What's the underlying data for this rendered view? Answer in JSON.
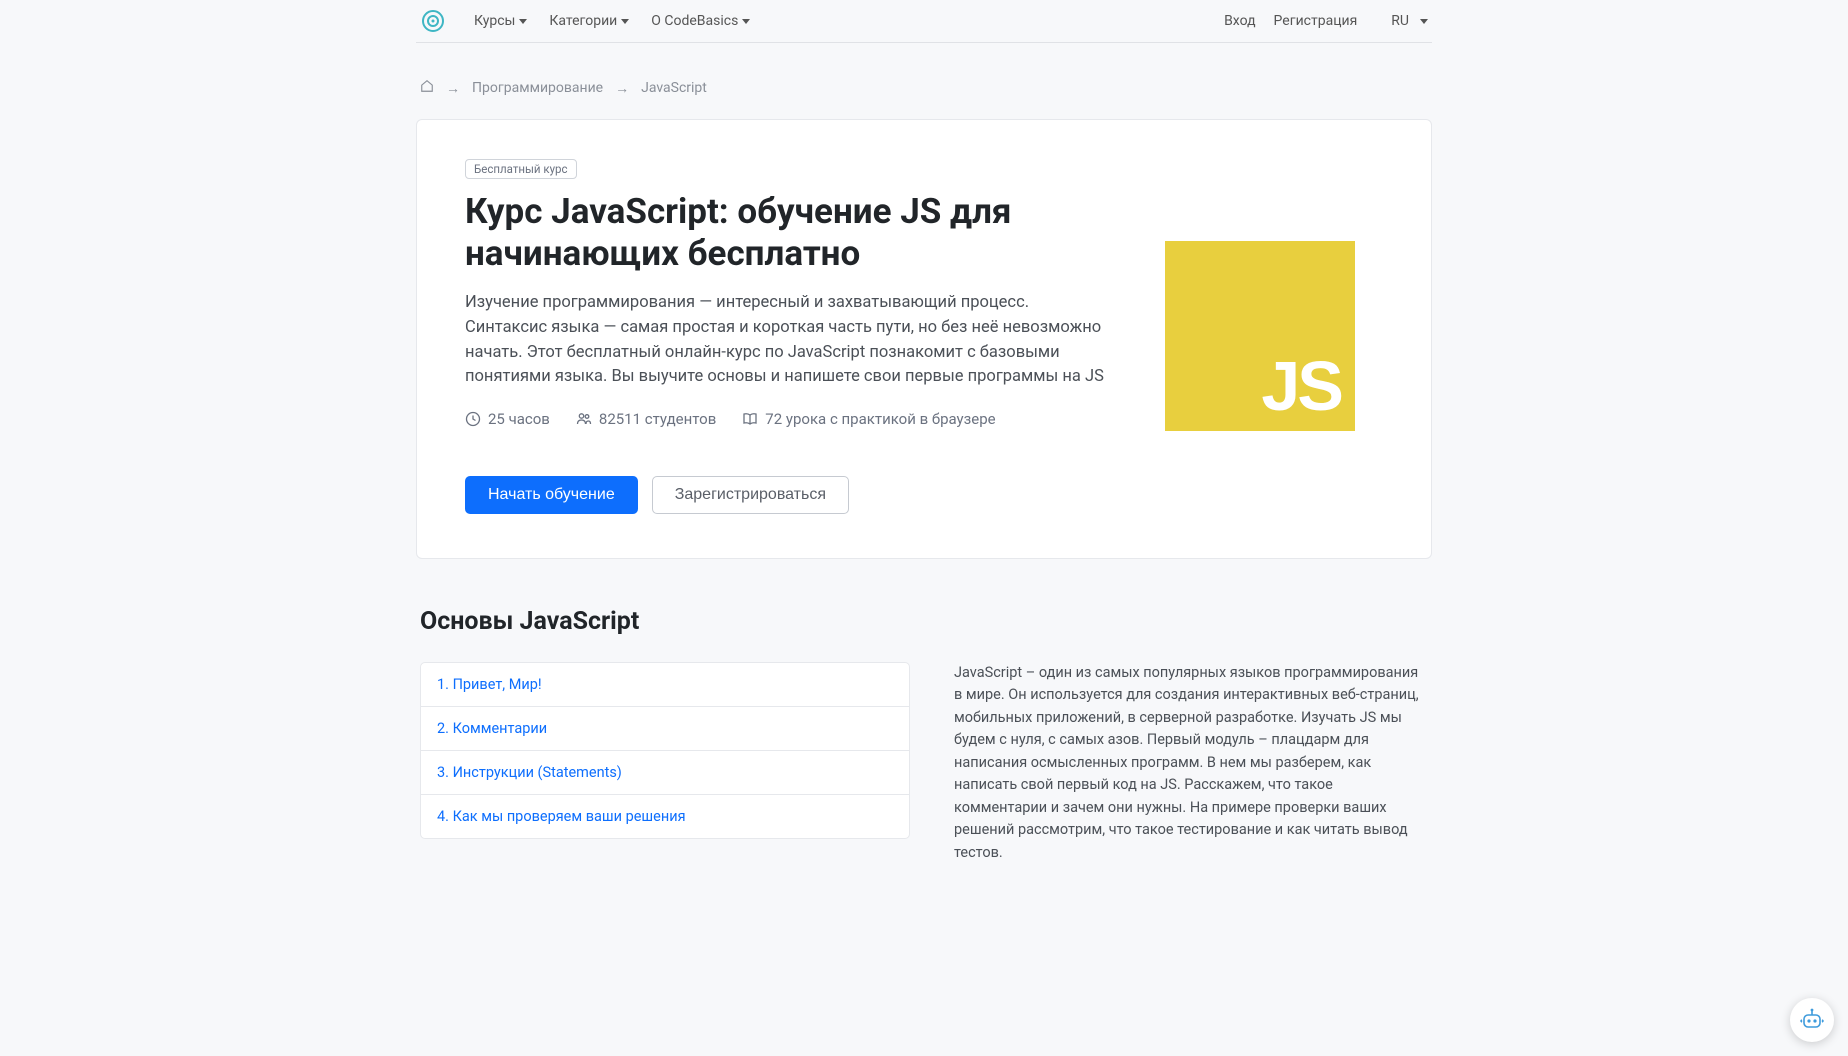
{
  "nav": {
    "courses": "Курсы",
    "categories": "Категории",
    "about": "О CodeBasics",
    "login": "Вход",
    "register": "Регистрация",
    "lang": "RU"
  },
  "breadcrumb": {
    "programming": "Программирование",
    "current": "JavaScript"
  },
  "hero": {
    "badge": "Бесплатный курс",
    "title": "Курс JavaScript: обучение JS для начинающих бесплатно",
    "description": "Изучение программирования — интересный и захватывающий процесс. Синтаксис языка — самая простая и короткая часть пути, но без неё невозможно начать. Этот бесплатный онлайн-курс по JavaScript познакомит с базовыми понятиями языка. Вы выучите основы и напишете свои первые программы на JS",
    "hours": "25 часов",
    "students": "82511 студентов",
    "lessons": "72 урока с практикой в браузере",
    "start_btn": "Начать обучение",
    "register_btn": "Зарегистрироваться",
    "logo_text": "JS"
  },
  "section": {
    "title": "Основы JavaScript",
    "module_desc": "JavaScript – один из самых популярных языков программирования в мире. Он используется для создания интерактивных веб-страниц, мобильных приложений, в серверной разработке. Изучать JS мы будем с нуля, с самых азов. Первый модуль – плацдарм  для написания осмысленных программ. В нем мы разберем, как написать свой первый код на JS. Расскажем, что такое комментарии и зачем они нужны. На примере проверки ваших решений рассмотрим, что такое тестирование и как читать вывод тестов."
  },
  "lessons": [
    "1. Привет, Мир!",
    "2. Комментарии",
    "3. Инструкции (Statements)",
    "4. Как мы проверяем ваши решения"
  ]
}
